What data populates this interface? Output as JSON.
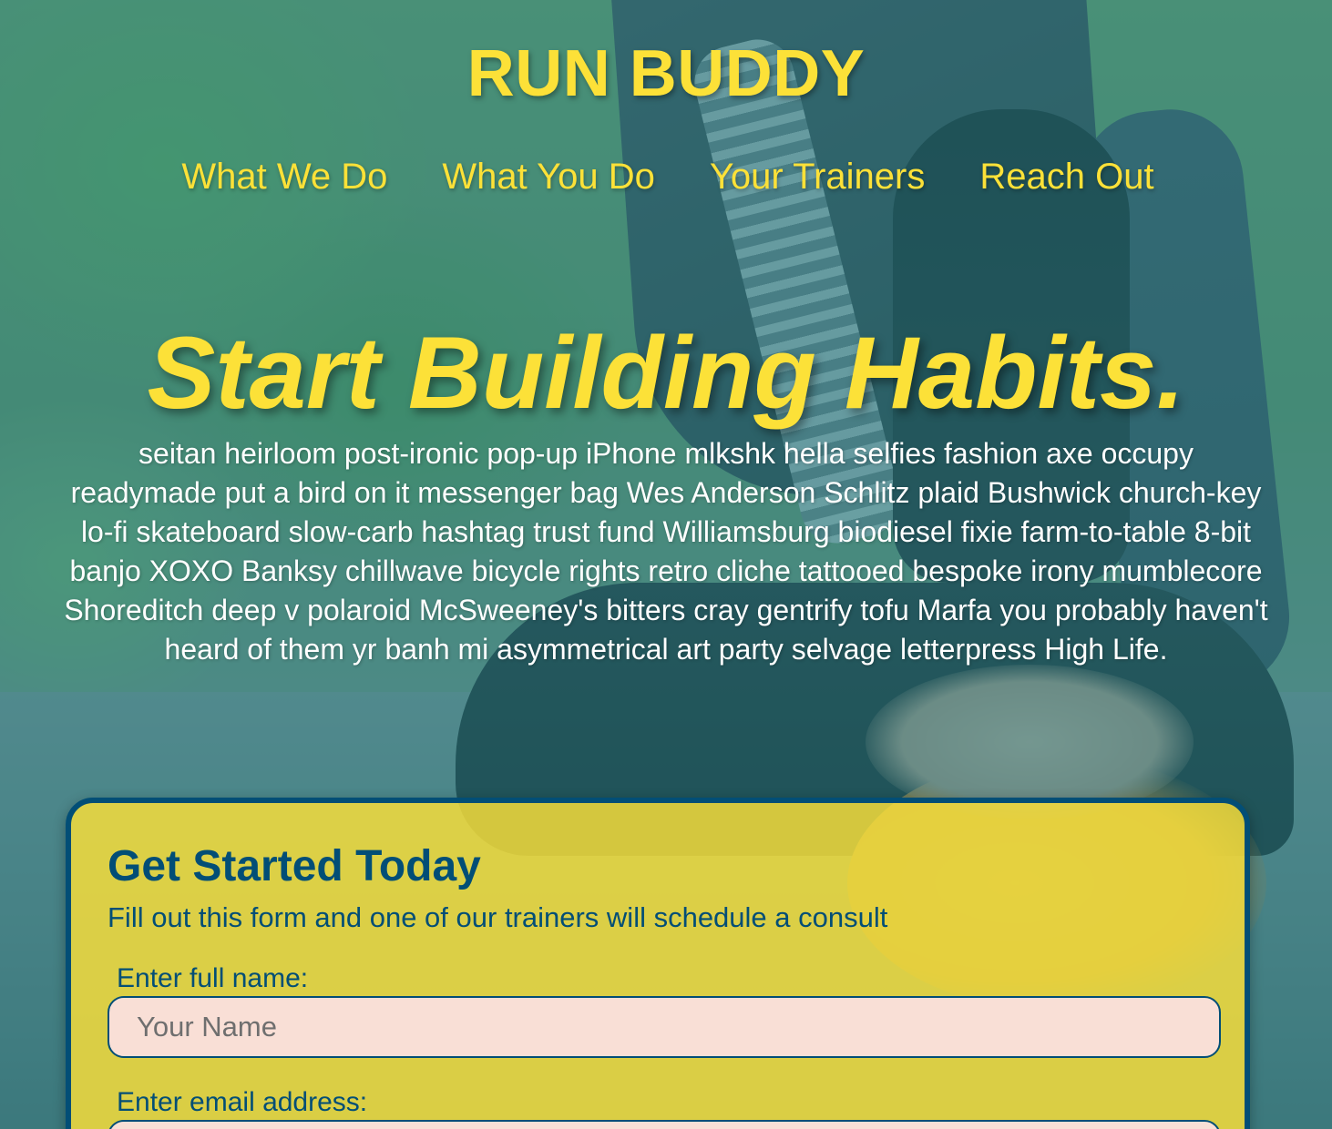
{
  "brand": {
    "logo": "RUN BUDDY",
    "accent_color": "#fce138",
    "dark_color": "#024e76"
  },
  "nav": {
    "items": [
      {
        "label": "What We Do"
      },
      {
        "label": "What You Do"
      },
      {
        "label": "Your Trainers"
      },
      {
        "label": "Reach Out"
      }
    ]
  },
  "hero": {
    "title": "Start Building Habits.",
    "body": "seitan heirloom post-ironic pop-up iPhone mlkshk hella selfies fashion axe occupy readymade put a bird on it messenger bag Wes Anderson Schlitz plaid Bushwick church-key lo-fi skateboard slow-carb hashtag trust fund Williamsburg biodiesel fixie farm-to-table 8-bit banjo XOXO Banksy chillwave bicycle rights retro cliche tattooed bespoke irony mumblecore Shoreditch deep v polaroid McSweeney's bitters cray gentrify tofu Marfa you probably haven't heard of them yr banh mi asymmetrical art party selvage letterpress High Life."
  },
  "signup_form": {
    "title": "Get Started Today",
    "subtitle": "Fill out this form and one of our trainers will schedule a consult",
    "name_label": "Enter full name:",
    "name_value": "",
    "name_placeholder": "Your Name",
    "email_label": "Enter email address:",
    "email_value": "",
    "email_placeholder": ""
  }
}
